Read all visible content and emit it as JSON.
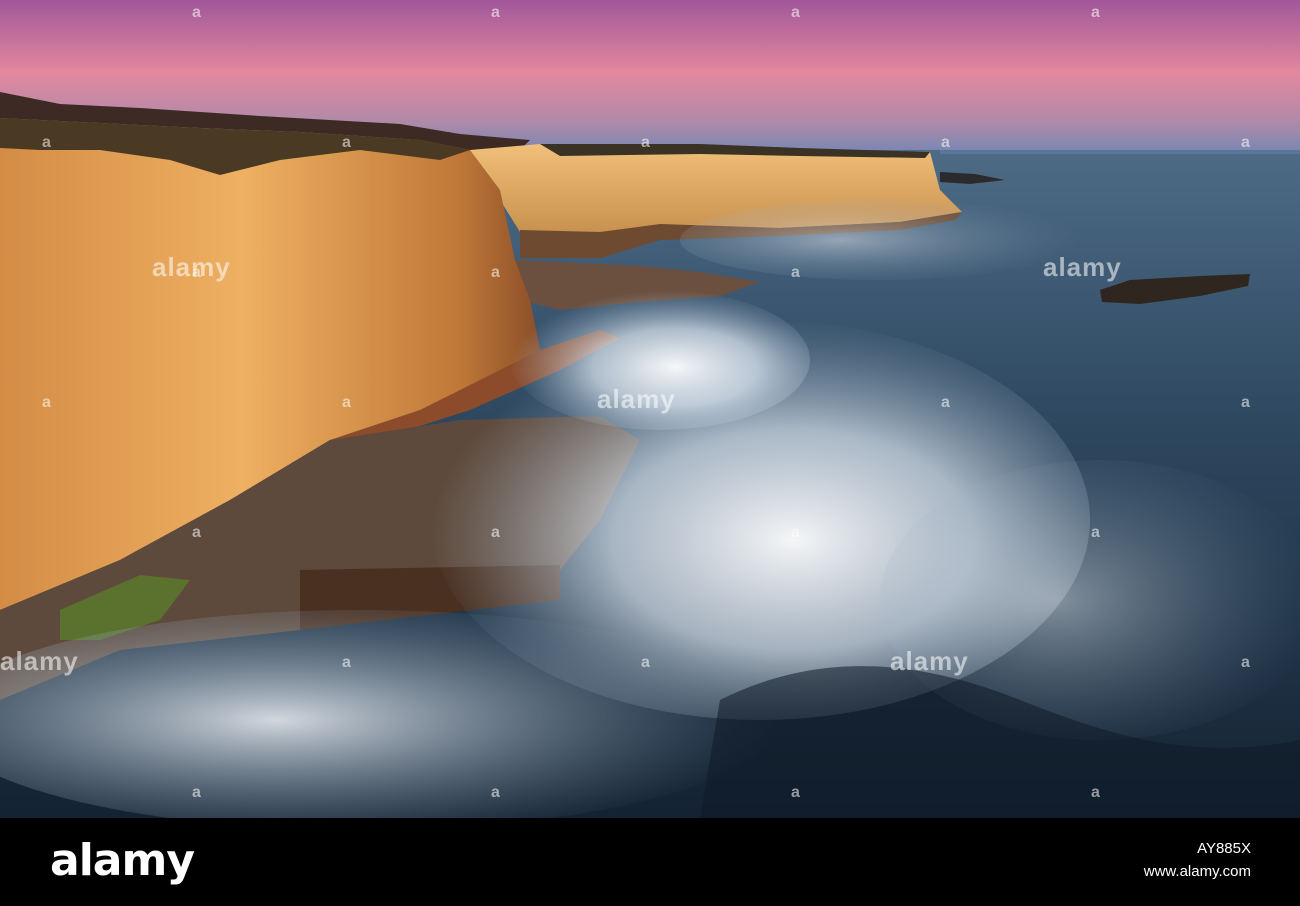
{
  "photo": {
    "subject": "sea-cliffs-and-breaking-waves-at-dusk",
    "colors": {
      "sky_top": "#c86a9c",
      "sky_mid": "#e58aa0",
      "sky_horizon": "#6f86b8",
      "cliff_lit": "#e8a85a",
      "cliff_shadow": "#7a4a28",
      "sea_dark": "#1d2e40",
      "sea_mid": "#3f5c74",
      "foam": "#e8eef5"
    }
  },
  "watermark": {
    "text": "alamy",
    "mark": "a"
  },
  "footer": {
    "brand": "alamy",
    "image_id": "AY885X",
    "site_url": "www.alamy.com"
  }
}
